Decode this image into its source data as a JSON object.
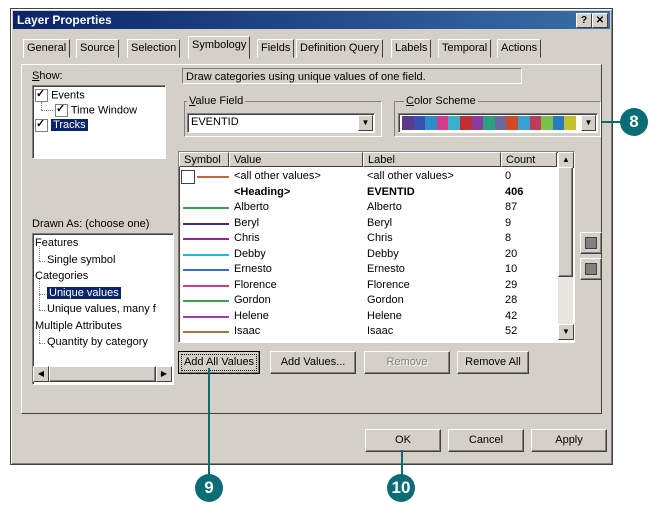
{
  "window": {
    "title": "Layer Properties",
    "help_label": "?",
    "close_label": "✕"
  },
  "tabs": [
    "General",
    "Source",
    "Selection",
    "Symbology",
    "Fields",
    "Definition Query",
    "Labels",
    "Temporal",
    "Actions"
  ],
  "show": {
    "label": "Show:",
    "items": [
      {
        "label": "Events",
        "checked": true
      },
      {
        "label": "Time Window",
        "checked": true
      },
      {
        "label": "Tracks",
        "checked": true
      }
    ]
  },
  "description": "Draw categories using unique values of one field.",
  "value_field": {
    "label": "Value Field",
    "value": "EVENTID"
  },
  "color_scheme": {
    "label": "Color Scheme",
    "swatches": [
      "#5b3a8c",
      "#3b4fb0",
      "#2a8fc8",
      "#d63a8a",
      "#3bb0c8",
      "#c03030",
      "#8c3ca0",
      "#2aa080",
      "#6a6aa0",
      "#d04a2a",
      "#3aa0d0",
      "#c03a5a",
      "#7ac050",
      "#2a7ac0",
      "#c0c030"
    ]
  },
  "drawn_as": {
    "label": "Drawn As: (choose one)",
    "items": [
      {
        "label": "Features",
        "level": 0
      },
      {
        "label": "Single symbol",
        "level": 1
      },
      {
        "label": "Categories",
        "level": 0
      },
      {
        "label": "Unique values",
        "level": 1,
        "selected": true
      },
      {
        "label": "Unique values, many f",
        "level": 1
      },
      {
        "label": "Multiple Attributes",
        "level": 0
      },
      {
        "label": "Quantity by category",
        "level": 1
      }
    ]
  },
  "table": {
    "columns": [
      "Symbol",
      "Value",
      "Label",
      "Count"
    ],
    "rows": [
      {
        "value": "<all other values>",
        "label": "<all other values>",
        "count": "0",
        "color": "#c8643c",
        "box": true
      },
      {
        "value": "<Heading>",
        "label": "EVENTID",
        "count": "406",
        "bold": true,
        "color": ""
      },
      {
        "value": "Alberto",
        "label": "Alberto",
        "count": "87",
        "color": "#3ca050"
      },
      {
        "value": "Beryl",
        "label": "Beryl",
        "count": "9",
        "color": "#3c2c8c"
      },
      {
        "value": "Chris",
        "label": "Chris",
        "count": "8",
        "color": "#8c2c8c"
      },
      {
        "value": "Debby",
        "label": "Debby",
        "count": "20",
        "color": "#2cb4c8"
      },
      {
        "value": "Ernesto",
        "label": "Ernesto",
        "count": "10",
        "color": "#3c6cc8"
      },
      {
        "value": "Florence",
        "label": "Florence",
        "count": "29",
        "color": "#c83c8c"
      },
      {
        "value": "Gordon",
        "label": "Gordon",
        "count": "28",
        "color": "#3ca050"
      },
      {
        "value": "Helene",
        "label": "Helene",
        "count": "42",
        "color": "#a03cb4"
      },
      {
        "value": "Isaac",
        "label": "Isaac",
        "count": "52",
        "color": "#a0783c"
      }
    ]
  },
  "buttons": {
    "add_all": "Add All Values",
    "add_values": "Add Values...",
    "remove": "Remove",
    "remove_all": "Remove All",
    "ok": "OK",
    "cancel": "Cancel",
    "apply": "Apply"
  },
  "callouts": [
    "8",
    "9",
    "10"
  ]
}
